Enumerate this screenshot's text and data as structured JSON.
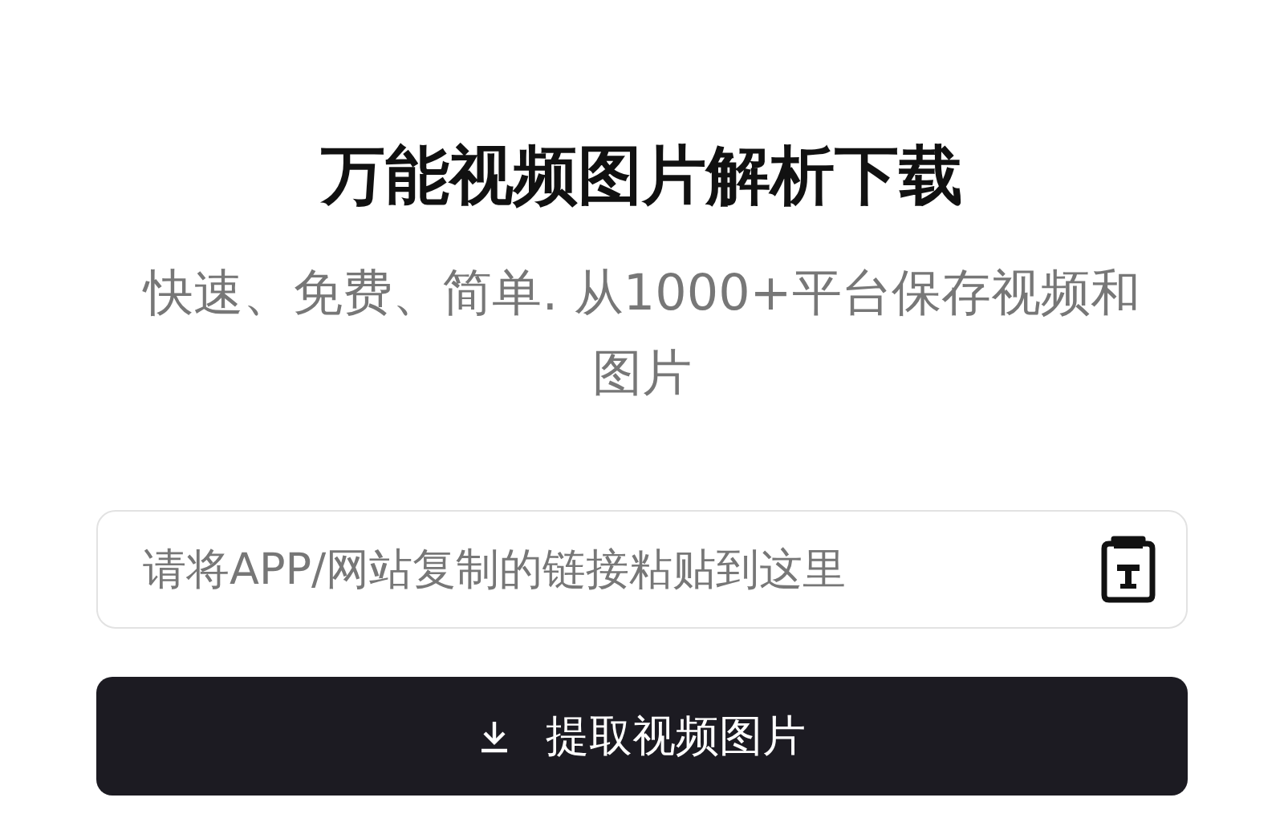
{
  "title": "万能视频图片解析下载",
  "subtitle": "快速、免费、简单. 从1000+平台保存视频和图片",
  "link_field": {
    "placeholder": "请将APP/网站复制的链接粘贴到这里"
  },
  "extract_button": {
    "label": "提取视频图片"
  }
}
